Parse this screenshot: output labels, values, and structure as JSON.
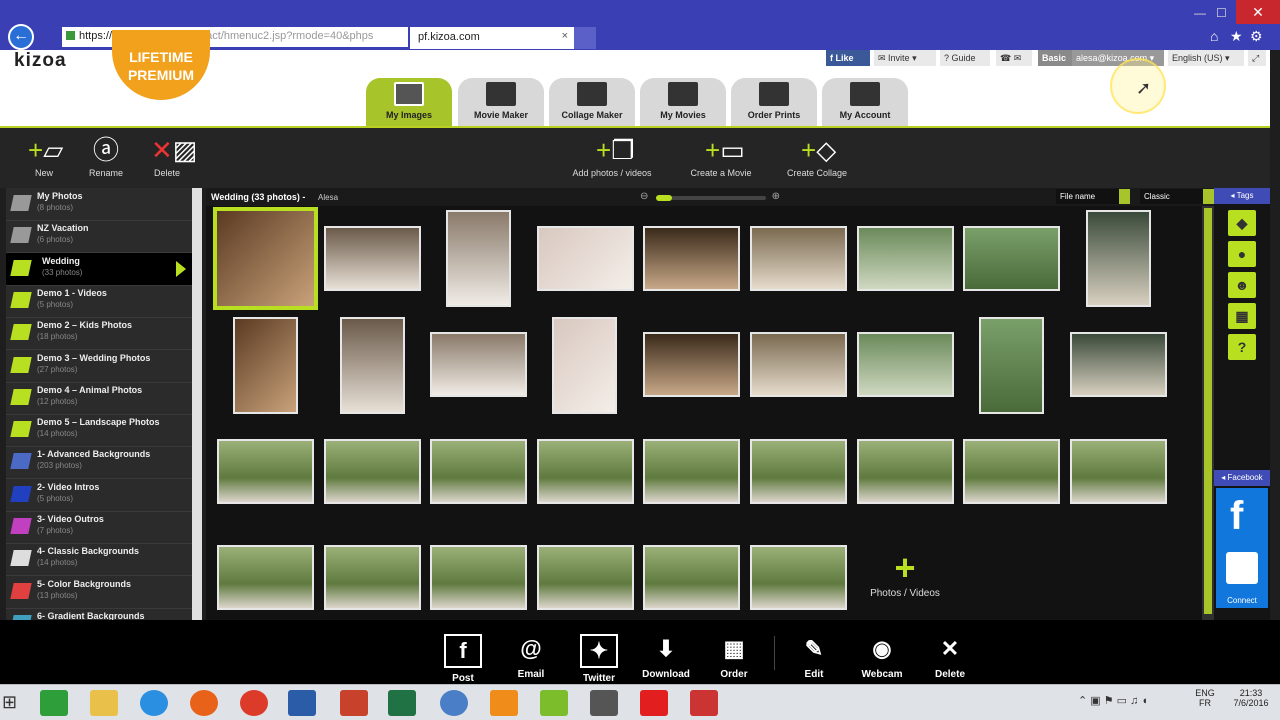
{
  "browser": {
    "url_main": "https://pf.kizoa.com",
    "url_rest": "/i-Contact/hmenuc2.jsp?rmode=40&phps",
    "tab_title": "pf.kizoa.com",
    "close_tab": "×",
    "win_close": "✕",
    "win_minimize": "—",
    "win_maximize": "☐"
  },
  "header": {
    "logo": "kizoa",
    "premium_line1": "LIFETIME",
    "premium_line2": "PREMIUM",
    "like": "Like",
    "invite": "Invite",
    "guide": "Guide",
    "plan": "Basic",
    "email": "alesa@kizoa.com",
    "language": "English (US)"
  },
  "nav_tabs": [
    {
      "label": "My Images",
      "active": true
    },
    {
      "label": "Movie Maker"
    },
    {
      "label": "Collage Maker"
    },
    {
      "label": "My Movies"
    },
    {
      "label": "Order Prints"
    },
    {
      "label": "My Account"
    }
  ],
  "toolbar": {
    "new": "New",
    "rename": "Rename",
    "delete": "Delete",
    "add_photos": "Add photos / videos",
    "create_movie": "Create a Movie",
    "create_collage": "Create Collage"
  },
  "albums": [
    {
      "name": "My Photos",
      "count": "(8 photos)"
    },
    {
      "name": "NZ Vacation",
      "count": "(6 photos)"
    },
    {
      "name": "Wedding",
      "count": "(33 photos)",
      "active": true
    },
    {
      "name": "Demo 1 - Videos",
      "count": "(5 photos)"
    },
    {
      "name": "Demo 2 – Kids Photos",
      "count": "(18 photos)"
    },
    {
      "name": "Demo 3 – Wedding Photos",
      "count": "(27 photos)"
    },
    {
      "name": "Demo 4 – Animal Photos",
      "count": "(12 photos)"
    },
    {
      "name": "Demo 5 – Landscape Photos",
      "count": "(14 photos)"
    },
    {
      "name": "1- Advanced Backgrounds",
      "count": "(203 photos)"
    },
    {
      "name": "2- Video Intros",
      "count": "(5 photos)"
    },
    {
      "name": "3- Video Outros",
      "count": "(7 photos)"
    },
    {
      "name": "4- Classic Backgrounds",
      "count": "(14 photos)"
    },
    {
      "name": "5- Color Backgrounds",
      "count": "(13 photos)"
    },
    {
      "name": "6- Gradient Backgrounds",
      "count": ""
    }
  ],
  "main": {
    "album_title": "Wedding  (33 photos)  -",
    "album_user": "Alesa",
    "sort_by": "File name",
    "view_mode": "Classic",
    "add_media_label": "Photos / Videos"
  },
  "right_panel": {
    "tags": "Tags",
    "facebook": "Facebook",
    "connect": "Connect"
  },
  "bottom_actions": {
    "post_facebook": "Post Facebook",
    "email": "Email",
    "twitter": "Twitter",
    "download": "Download",
    "order": "Order",
    "edit": "Edit",
    "webcam": "Webcam",
    "delete": "Delete"
  },
  "taskbar": {
    "lang_line1": "ENG",
    "lang_line2": "FR",
    "time": "21:33",
    "date": "7/6/2016"
  },
  "colors": {
    "accent": "#b8e021",
    "browser": "#3a3fb4",
    "premium": "#f1a11b"
  }
}
